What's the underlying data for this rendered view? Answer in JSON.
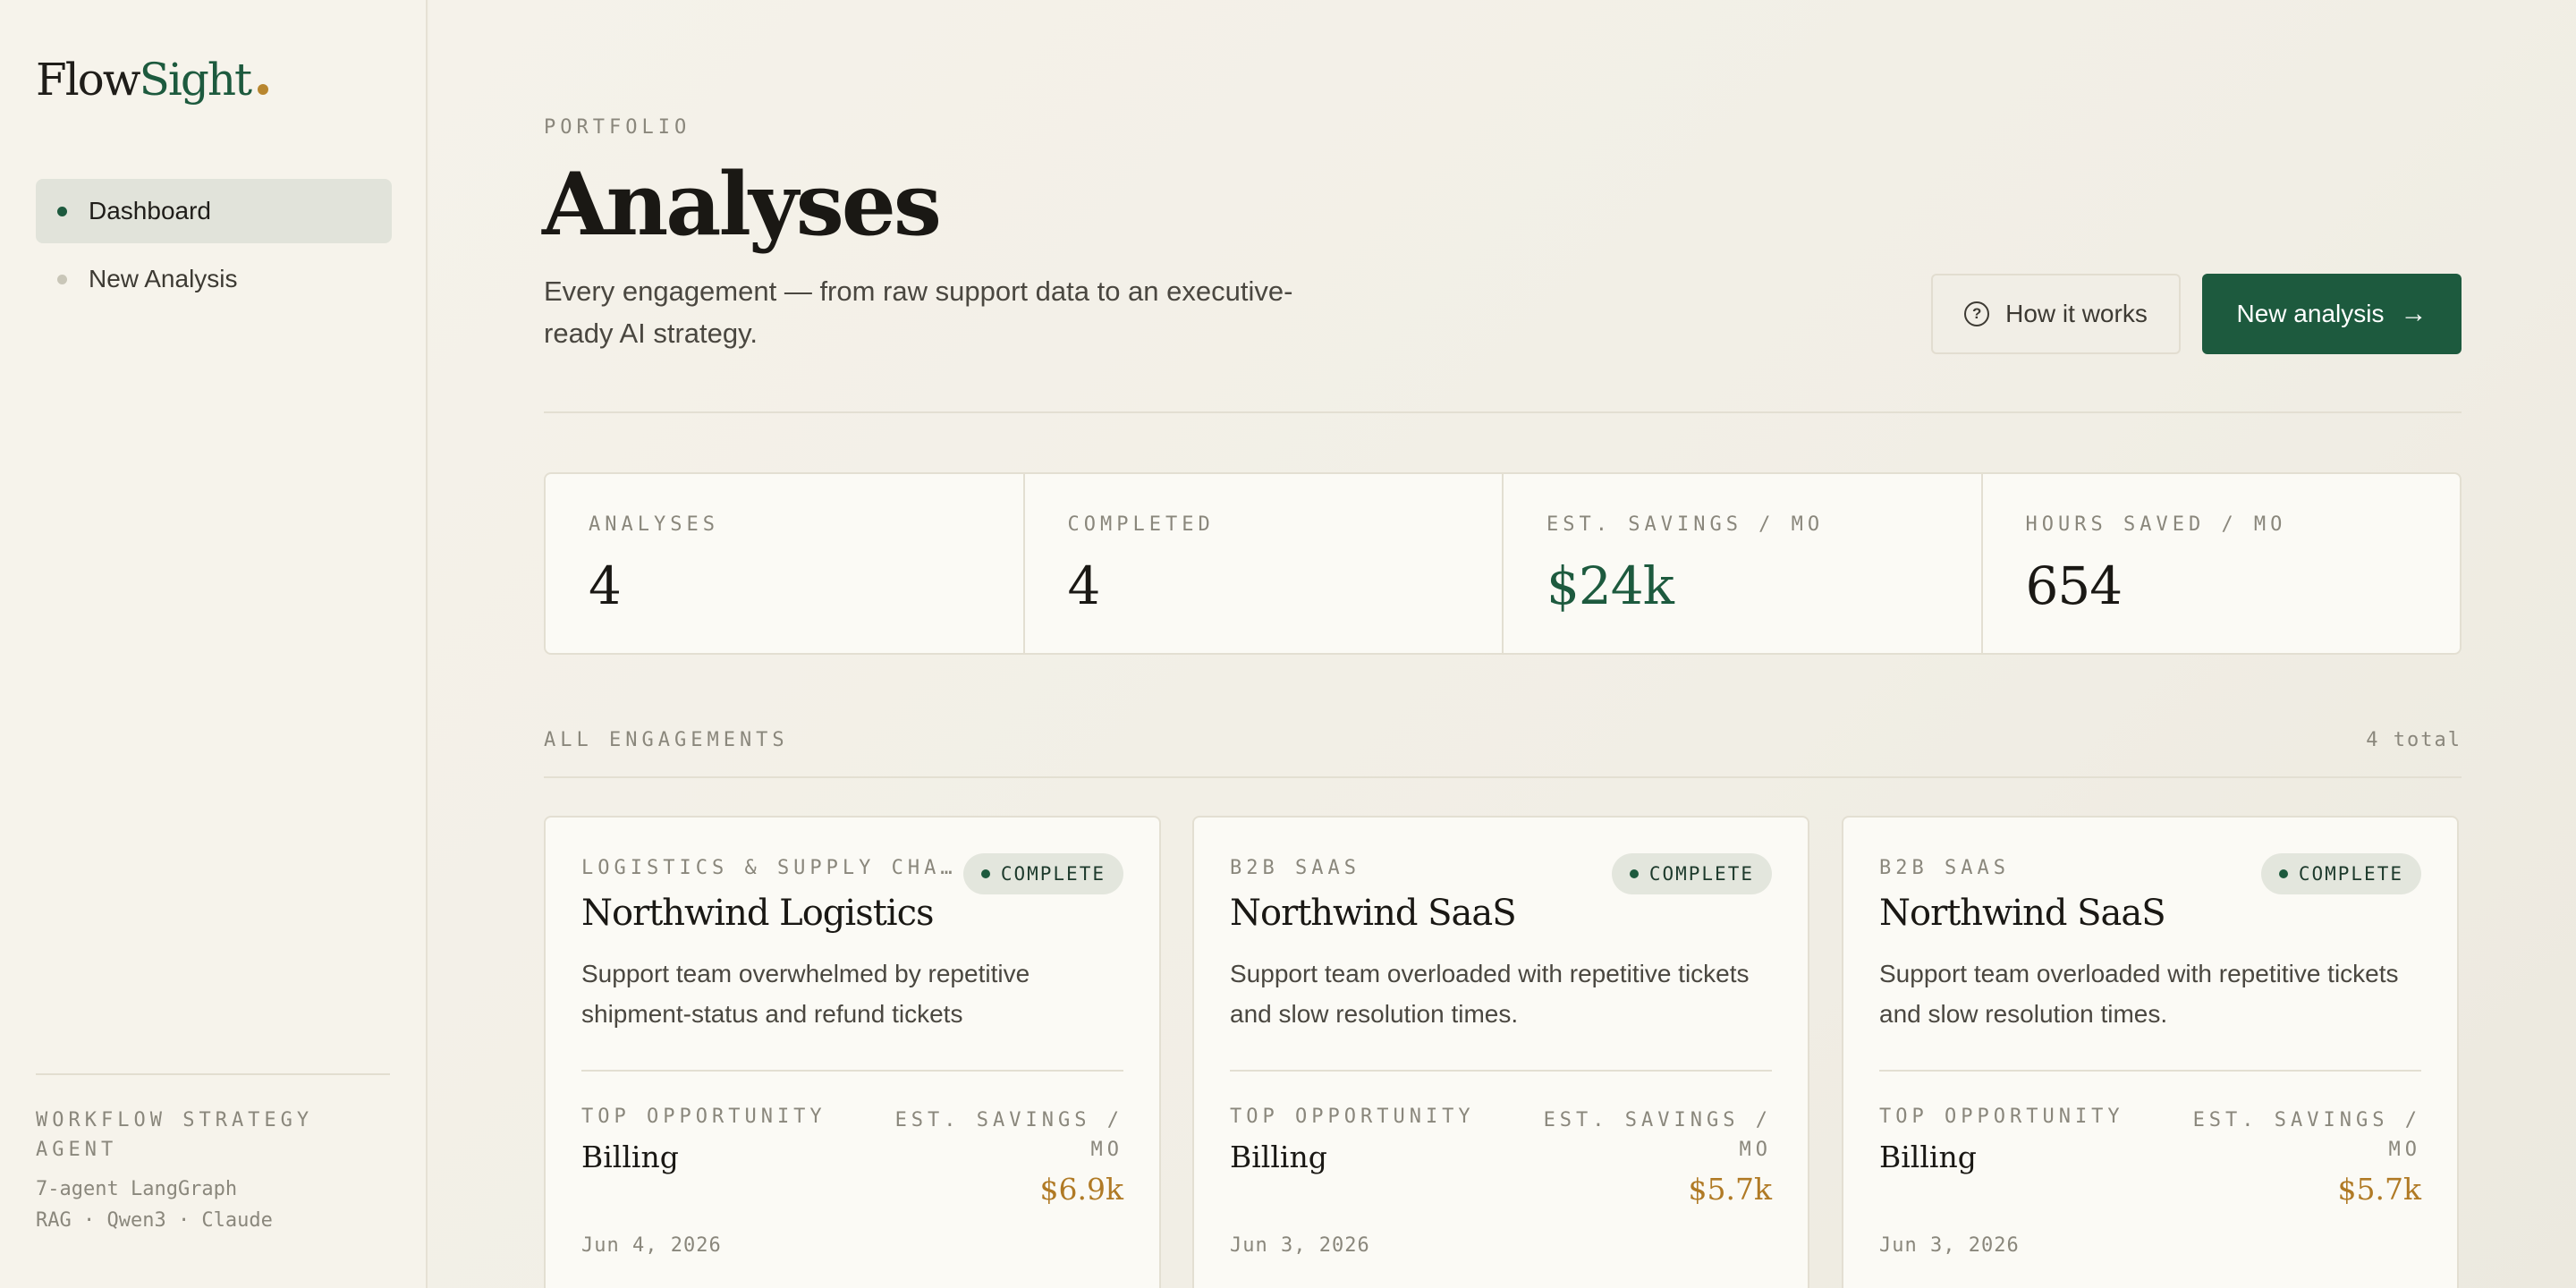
{
  "brand": {
    "name_part1": "Flow",
    "name_part2": "Sight",
    "accent_color": "#1d5a3e",
    "dot_color": "#b8862e"
  },
  "sidebar": {
    "items": [
      {
        "label": "Dashboard",
        "active": true
      },
      {
        "label": "New Analysis",
        "active": false
      }
    ],
    "footer": {
      "title": "WORKFLOW STRATEGY AGENT",
      "line1": "7-agent LangGraph",
      "line2": "RAG · Qwen3 · Claude"
    }
  },
  "header": {
    "eyebrow": "PORTFOLIO",
    "title": "Analyses",
    "subtitle": "Every engagement — from raw support data to an executive-ready AI strategy.",
    "how_it_works_label": "How it works",
    "how_it_works_icon": "question-circle-icon",
    "new_analysis_label": "New analysis",
    "new_analysis_icon": "arrow-right-icon"
  },
  "stats": [
    {
      "label": "ANALYSES",
      "value": "4"
    },
    {
      "label": "COMPLETED",
      "value": "4"
    },
    {
      "label": "EST. SAVINGS / MO",
      "value": "$24k",
      "highlight": true
    },
    {
      "label": "HOURS SAVED / MO",
      "value": "654"
    }
  ],
  "engagements": {
    "label": "ALL ENGAGEMENTS",
    "count": "4 total",
    "cards": [
      {
        "industry": "LOGISTICS & SUPPLY CHA…",
        "status": "COMPLETE",
        "title": "Northwind Logistics",
        "description": "Support team overwhelmed by repetitive shipment-status and refund tickets",
        "opportunity_label": "TOP OPPORTUNITY",
        "opportunity": "Billing",
        "savings_label": "EST. SAVINGS / MO",
        "savings": "$6.9k",
        "date": "Jun 4, 2026"
      },
      {
        "industry": "B2B SAAS",
        "status": "COMPLETE",
        "title": "Northwind SaaS",
        "description": "Support team overloaded with repetitive tickets and slow resolution times.",
        "opportunity_label": "TOP OPPORTUNITY",
        "opportunity": "Billing",
        "savings_label": "EST. SAVINGS / MO",
        "savings": "$5.7k",
        "date": "Jun 3, 2026"
      },
      {
        "industry": "B2B SAAS",
        "status": "COMPLETE",
        "title": "Northwind SaaS",
        "description": "Support team overloaded with repetitive tickets and slow resolution times.",
        "opportunity_label": "TOP OPPORTUNITY",
        "opportunity": "Billing",
        "savings_label": "EST. SAVINGS / MO",
        "savings": "$5.7k",
        "date": "Jun 3, 2026"
      }
    ]
  }
}
